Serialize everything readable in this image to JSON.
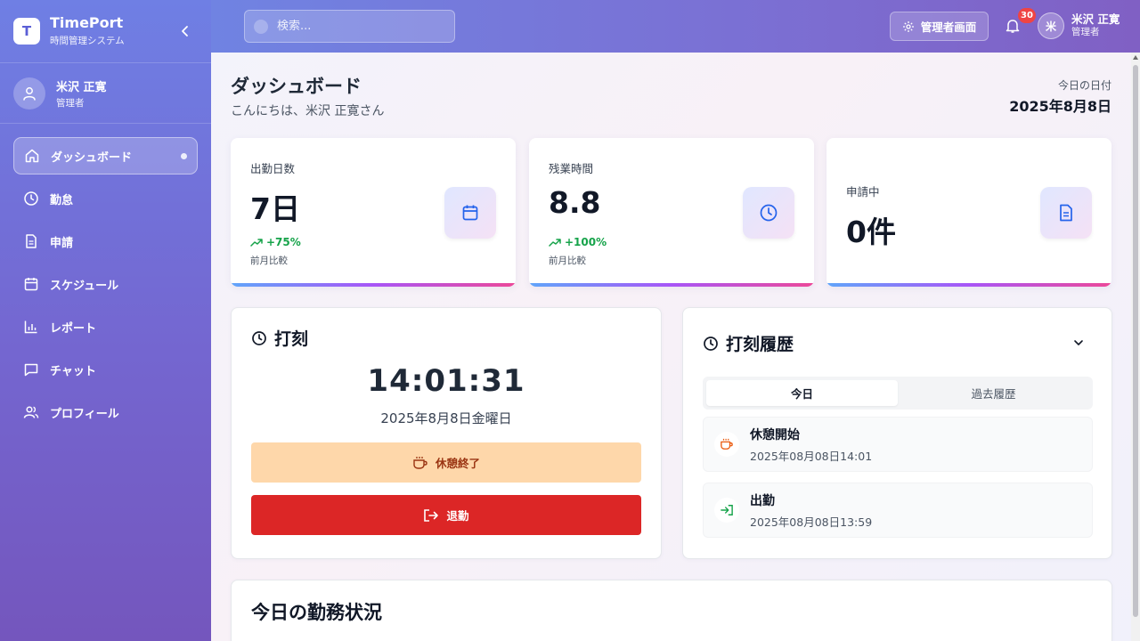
{
  "app": {
    "name": "TimePort",
    "subtitle": "時間管理システム",
    "logo_letter": "T"
  },
  "user": {
    "name": "米沢 正寛",
    "role": "管理者",
    "initial": "米"
  },
  "nav": [
    {
      "label": "ダッシュボード",
      "icon": "home-icon",
      "active": true
    },
    {
      "label": "勤怠",
      "icon": "clock-icon"
    },
    {
      "label": "申請",
      "icon": "document-icon"
    },
    {
      "label": "スケジュール",
      "icon": "calendar-icon"
    },
    {
      "label": "レポート",
      "icon": "bar-chart-icon"
    },
    {
      "label": "チャット",
      "icon": "chat-icon"
    },
    {
      "label": "プロフィール",
      "icon": "users-icon"
    }
  ],
  "topbar": {
    "search_placeholder": "検索...",
    "admin_label": "管理者画面",
    "notification_count": "30"
  },
  "page": {
    "title": "ダッシュボード",
    "greeting": "こんにちは、米沢 正寛さん",
    "date_label": "今日の日付",
    "date_value": "2025年8月8日"
  },
  "stats": [
    {
      "label": "出勤日数",
      "value": "7日",
      "trend": "+75%",
      "compare": "前月比較",
      "icon": "calendar-icon"
    },
    {
      "label": "残業時間",
      "value": "8.8",
      "trend": "+100%",
      "compare": "前月比較",
      "icon": "clock-icon"
    },
    {
      "label": "申請中",
      "value": "0件",
      "icon": "document-icon"
    }
  ],
  "punch": {
    "title": "打刻",
    "time": "14:01:31",
    "date": "2025年8月8日金曜日",
    "break_end_label": "休憩終了",
    "leave_label": "退勤"
  },
  "history": {
    "title": "打刻履歴",
    "tabs": [
      "今日",
      "過去履歴"
    ],
    "items": [
      {
        "title": "休憩開始",
        "time": "2025年08月08日14:01",
        "icon": "coffee-icon",
        "color": "#ea580c"
      },
      {
        "title": "出勤",
        "time": "2025年08月08日13:59",
        "icon": "login-icon",
        "color": "#16a34a"
      }
    ]
  },
  "today_status": {
    "title": "今日の勤務状況"
  },
  "colors": {
    "accent": "#7466d0",
    "danger": "#dc2626",
    "break": "#fed7aa",
    "success": "#16a34a"
  }
}
